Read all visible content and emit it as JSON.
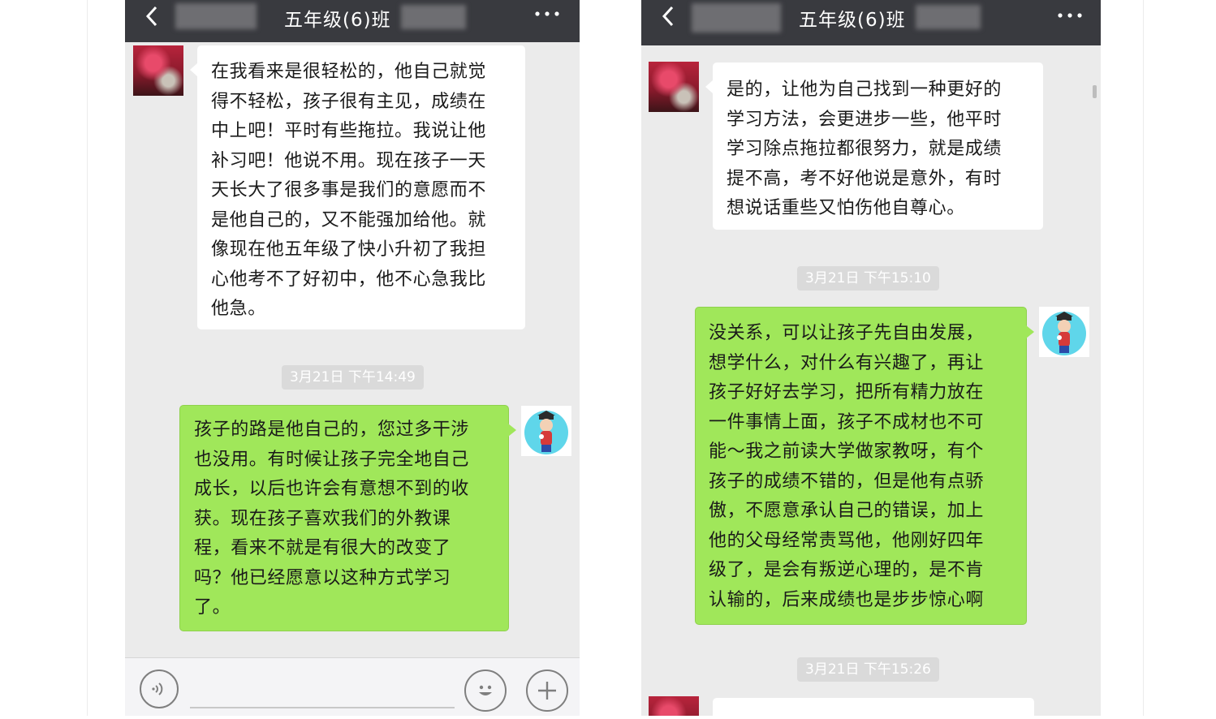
{
  "chat_title": "五年级(6)班",
  "left": {
    "incoming_message": "在我看来是很轻松的，他自己就觉\n得不轻松，孩子很有主见，成绩在\n中上吧！平时有些拖拉。我说让他\n补习吧！他说不用。现在孩子一天\n天长大了很多事是我们的意愿而不\n是他自己的，又不能强加给他。就\n像现在他五年级了快小升初了我担\n心他考不了好初中，他不心急我比\n他急。",
    "timestamp": "3月21日 下午14:49",
    "outgoing_message": "孩子的路是他自己的，您过多干涉\n也没用。有时候让孩子完全地自己\n成长，以后也许会有意想不到的收\n获。现在孩子喜欢我们的外教课\n程，看来不就是有很大的改变了\n吗？他已经愿意以这种方式学习\n了。"
  },
  "right": {
    "incoming_message": "是的，让他为自己找到一种更好的\n学习方法，会更进步一些，他平时\n学习除点拖拉都很努力，就是成绩\n提不高，考不好他说是意外，有时\n想说话重些又怕伤他自尊心。",
    "timestamp_1": "3月21日 下午15:10",
    "outgoing_message": "没关系，可以让孩子先自由发展，\n想学什么，对什么有兴趣了，再让\n孩子好好去学习，把所有精力放在\n一件事情上面，孩子不成材也不可\n能～我之前读大学做家教呀，有个\n孩子的成绩不错的，但是他有点骄\n傲，不愿意承认自己的错误，加上\n他的父母经常责骂他，他刚好四年\n级了，是会有叛逆心理的，是不肯\n认输的，后来成绩也是步步惊心啊",
    "timestamp_2": "3月21日 下午15:26"
  },
  "icons": {
    "back": "chevron-left-icon",
    "more": "more-icon",
    "voice": "voice-icon",
    "emoji": "emoji-icon",
    "add": "plus-icon"
  },
  "colors": {
    "header_bg": "#393a3f",
    "chat_bg": "#ebebeb",
    "incoming_bubble": "#ffffff",
    "outgoing_bubble": "#a0e75a",
    "timestamp_bg": "#dadada"
  }
}
